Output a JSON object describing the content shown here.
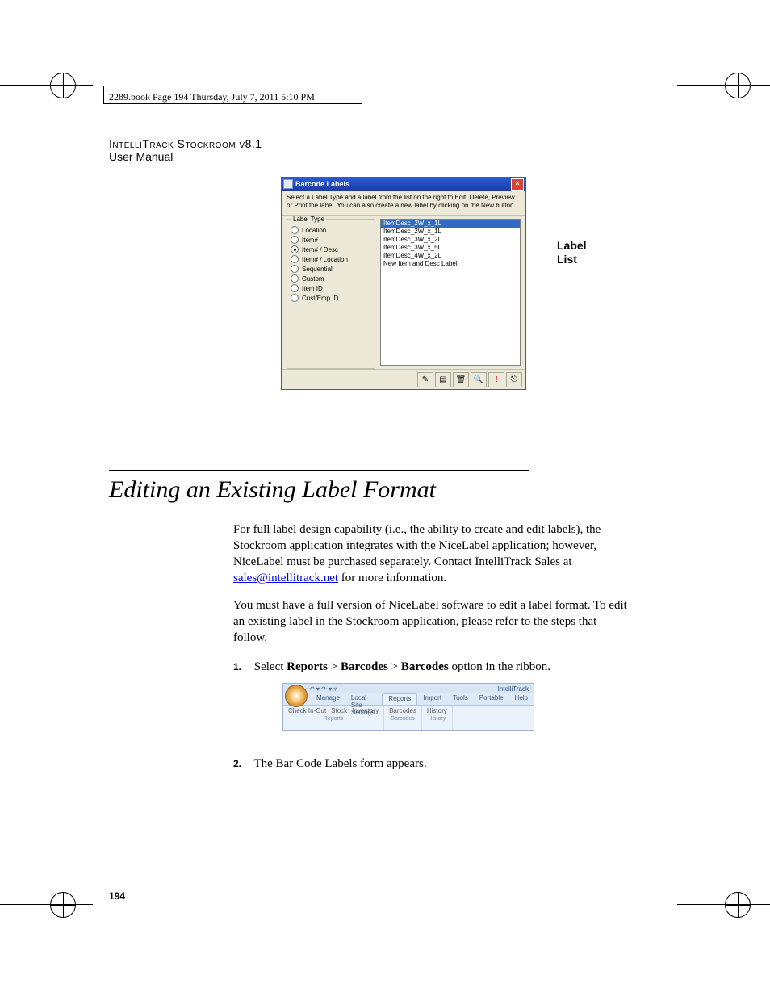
{
  "header": {
    "book_line": "2289.book  Page 194  Thursday, July 7, 2011  5:10 PM",
    "product_line1": "IntelliTrack Stockroom v8.1",
    "product_line2": "User Manual"
  },
  "dialog": {
    "title": "Barcode Labels",
    "instruction": "Select a Label Type and a label from the list on the right to Edit, Delete, Preview or Print the label. You can also create a new label by clicking on the New button.",
    "group_legend": "Label Type",
    "radios": [
      {
        "label": "Location",
        "selected": false
      },
      {
        "label": "Item#",
        "selected": false
      },
      {
        "label": "Item# / Desc",
        "selected": true
      },
      {
        "label": "Item# / Location",
        "selected": false
      },
      {
        "label": "Sequential",
        "selected": false
      },
      {
        "label": "Custom",
        "selected": false
      },
      {
        "label": "Item ID",
        "selected": false
      },
      {
        "label": "Cust/Emp ID",
        "selected": false
      }
    ],
    "list_items": [
      {
        "text": "ItemDesc_2W_x_1L",
        "selected": true
      },
      {
        "text": "ItemDesc_2W_x_1L",
        "selected": false
      },
      {
        "text": "ItemDesc_3W_x_2L",
        "selected": false
      },
      {
        "text": "ItemDesc_3W_x_5L",
        "selected": false
      },
      {
        "text": "ItemDesc_4W_x_2L",
        "selected": false
      },
      {
        "text": "New Item and Desc Label",
        "selected": false
      }
    ],
    "callout": "Label List"
  },
  "section": {
    "heading": "Editing an Existing Label Format",
    "p1a": "For full label design capability (i.e., the ability to create and edit labels), the Stockroom application integrates with the NiceLabel application; however, NiceLabel must be purchased separately. Contact IntelliTrack Sales at ",
    "email": "sales@intellitrack.net",
    "p1b": " for more information.",
    "p2": "You must have a full version of NiceLabel software to edit a label format. To edit an existing label in the Stockroom application, please refer to the steps that follow.",
    "step1_num": "1.",
    "step1a": "Select ",
    "step1b": "Reports",
    "step1c": " > ",
    "step1d": "Barcodes",
    "step1e": " > ",
    "step1f": "Barcodes",
    "step1g": " option in the ribbon.",
    "step2_num": "2.",
    "step2": "The Bar Code Labels form appears."
  },
  "ribbon": {
    "app_title": "IntelliTrack",
    "tabs": [
      "Manage",
      "Local Site Settings",
      "Reports",
      "Import",
      "Tools",
      "Portable",
      "Help"
    ],
    "groups": [
      {
        "items": [
          "Check In-Out",
          "Stock",
          "Inventory"
        ],
        "label": "Reports"
      },
      {
        "items": [
          "Barcodes"
        ],
        "label": "Barcodes"
      },
      {
        "items": [
          "History"
        ],
        "label": "History"
      }
    ]
  },
  "page_number": "194"
}
